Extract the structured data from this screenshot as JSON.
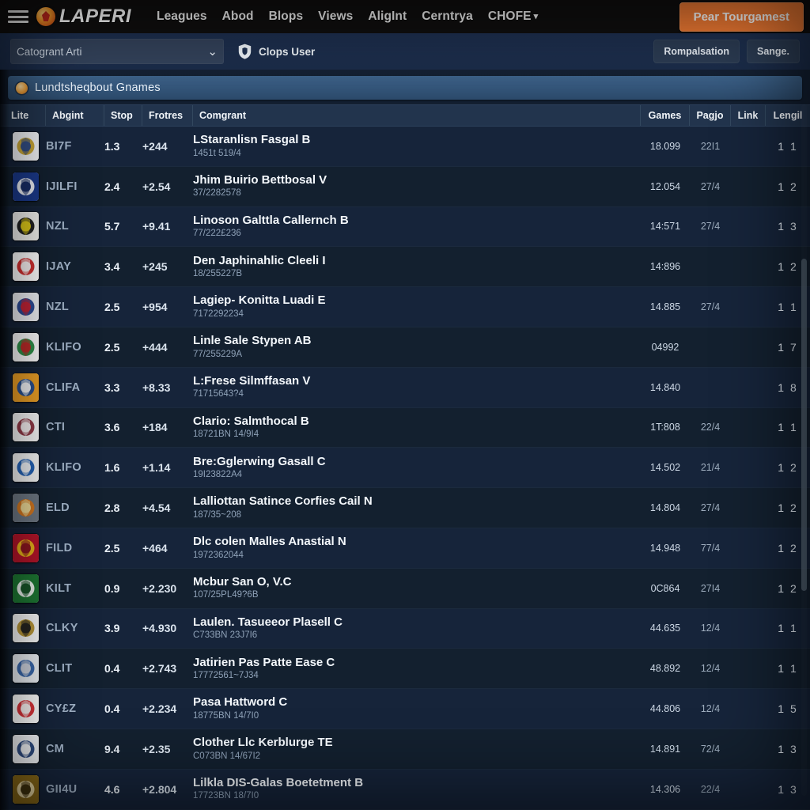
{
  "topnav": {
    "menu_icon": "hamburger-icon",
    "brand": "LAPERI",
    "links": [
      {
        "label": "Leagues"
      },
      {
        "label": "Abod"
      },
      {
        "label": "Blops"
      },
      {
        "label": "Views"
      },
      {
        "label": "AligInt"
      },
      {
        "label": "Cerntrya"
      },
      {
        "label": "CHOFE",
        "caret": "▾"
      }
    ],
    "cta_label": "Pear Tourgamest",
    "cta_color": "#f07a33",
    "background": "#100f0f"
  },
  "subbar": {
    "select_value": "Catogrant Arti",
    "select_chevron": "⌄",
    "shield_icon": "shield-icon",
    "user_label": "Clops User",
    "buttons": [
      {
        "label": "Rompalsation"
      },
      {
        "label": "Sange."
      }
    ]
  },
  "banner": {
    "icon": "ball-icon",
    "title": "Lundtsheqbout Gnames",
    "color": "#3c6188"
  },
  "table": {
    "columns": [
      {
        "key": "lite",
        "label": "Lite"
      },
      {
        "key": "abgint",
        "label": "Abgint"
      },
      {
        "key": "stop",
        "label": "Stop"
      },
      {
        "key": "frot",
        "label": "Frotres"
      },
      {
        "key": "cong",
        "label": "Comgrant"
      },
      {
        "key": "games",
        "label": "Games"
      },
      {
        "key": "pagjo",
        "label": "Pagjo"
      },
      {
        "key": "link",
        "label": "Link"
      },
      {
        "key": "lengil",
        "label": "Lengil"
      }
    ],
    "rows": [
      {
        "abbr": "BI7F",
        "stop": "1.3",
        "frot": "+244",
        "name": "LStaranlisn Fasgal B",
        "sub": "1451t 519/4",
        "games": "18.099",
        "pagjo": "22I1",
        "link": "",
        "lengil": "1 1"
      },
      {
        "abbr": "IJILFI",
        "stop": "2.4",
        "frot": "+2.54",
        "name": "Jhim Buirio Bettbosal V",
        "sub": "37/2282578",
        "games": "12.054",
        "pagjo": "27/4",
        "link": "",
        "lengil": "1 2"
      },
      {
        "abbr": "NZL",
        "stop": "5.7",
        "frot": "+9.41",
        "name": "Linoson Galttla Callernch B",
        "sub": "77/222£236",
        "games": "14:571",
        "pagjo": "27/4",
        "link": "",
        "lengil": "1 3"
      },
      {
        "abbr": "IJAY",
        "stop": "3.4",
        "frot": "+245",
        "name": "Den Japhinahlic Cleeli I",
        "sub": "18/255227B",
        "games": "14:896",
        "pagjo": "",
        "link": "",
        "lengil": "1 2"
      },
      {
        "abbr": "NZL",
        "stop": "2.5",
        "frot": "+954",
        "name": "Lagiep- Konitta Luadi E",
        "sub": "7172292234",
        "games": "14.885",
        "pagjo": "27/4",
        "link": "",
        "lengil": "1 1"
      },
      {
        "abbr": "KLIFO",
        "stop": "2.5",
        "frot": "+444",
        "name": "Linle Sale Stypen AB",
        "sub": "77/255229A",
        "games": "04992",
        "pagjo": "",
        "link": "",
        "lengil": "1 7"
      },
      {
        "abbr": "CLIFA",
        "stop": "3.3",
        "frot": "+8.33",
        "name": "L:Frese Silmffasan V",
        "sub": "71715643?4",
        "games": "14.840",
        "pagjo": "",
        "link": "",
        "lengil": "1 8"
      },
      {
        "abbr": "CTI",
        "stop": "3.6",
        "frot": "+184",
        "name": "Clario: Salmthocal B",
        "sub": "18721BN 14/9I4",
        "games": "1T:808",
        "pagjo": "22/4",
        "link": "",
        "lengil": "1 1"
      },
      {
        "abbr": "KLIFO",
        "stop": "1.6",
        "frot": "+1.14",
        "name": "Bre:Gglerwing Gasall C",
        "sub": "19I23822A4",
        "games": "14.502",
        "pagjo": "21/4",
        "link": "",
        "lengil": "1 2"
      },
      {
        "abbr": "ELD",
        "stop": "2.8",
        "frot": "+4.54",
        "name": "Lalliottan Satince Corfies Cail N",
        "sub": "187/35~208",
        "games": "14.804",
        "pagjo": "27/4",
        "link": "",
        "lengil": "1 2"
      },
      {
        "abbr": "FILD",
        "stop": "2.5",
        "frot": "+464",
        "name": "Dlc colen Malles Anastial N",
        "sub": "1972362044",
        "games": "14.948",
        "pagjo": "77/4",
        "link": "",
        "lengil": "1 2"
      },
      {
        "abbr": "KILT",
        "stop": "0.9",
        "frot": "+2.230",
        "name": "Mcbur San O, V.C",
        "sub": "107/25PL49?6B",
        "games": "0C864",
        "pagjo": "27I4",
        "link": "",
        "lengil": "1 2"
      },
      {
        "abbr": "CLKY",
        "stop": "3.9",
        "frot": "+4.930",
        "name": "Laulen. Tasueeor Plasell C",
        "sub": "C733BN 23J7I6",
        "games": "44.635",
        "pagjo": "12/4",
        "link": "",
        "lengil": "1 1"
      },
      {
        "abbr": "CLIT",
        "stop": "0.4",
        "frot": "+2.743",
        "name": "Jatirien Pas Patte Ease C",
        "sub": "17772561~7J34",
        "games": "48.892",
        "pagjo": "12/4",
        "link": "",
        "lengil": "1 1"
      },
      {
        "abbr": "CY£Z",
        "stop": "0.4",
        "frot": "+2.234",
        "name": "Pasa Hattword C",
        "sub": "18775BN 14/7I0",
        "games": "44.806",
        "pagjo": "12/4",
        "link": "",
        "lengil": "1 5"
      },
      {
        "abbr": "CM",
        "stop": "9.4",
        "frot": "+2.35",
        "name": "Clother Llc Kerblurge TE",
        "sub": "C073BN 14/67I2",
        "games": "14.891",
        "pagjo": "72/4",
        "link": "",
        "lengil": "1 3"
      },
      {
        "abbr": "GII4U",
        "stop": "4.6",
        "frot": "+2.804",
        "name": "Lilkla DIS-Galas Boetetment B",
        "sub": "17723BN 18/7I0",
        "games": "14.306",
        "pagjo": "22/4",
        "link": "",
        "lengil": "1 3"
      }
    ]
  }
}
